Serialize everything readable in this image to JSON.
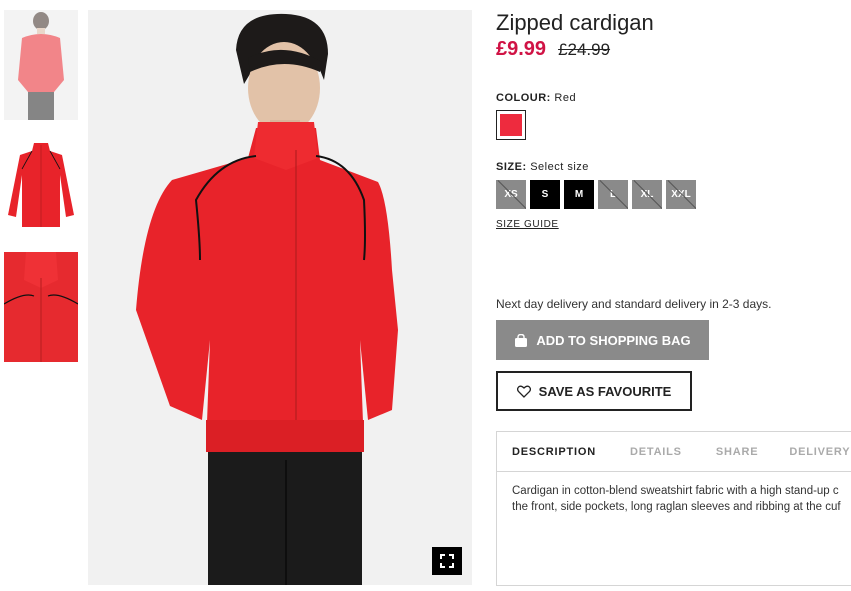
{
  "product": {
    "title": "Zipped cardigan",
    "price_now": "£9.99",
    "price_old": "£24.99"
  },
  "colour": {
    "label": "COLOUR:",
    "value": "Red",
    "swatch_color": "#ee2b3e"
  },
  "size": {
    "label": "SIZE:",
    "prompt": "Select size",
    "options": [
      {
        "label": "XS",
        "available": false
      },
      {
        "label": "S",
        "available": true
      },
      {
        "label": "M",
        "available": true
      },
      {
        "label": "L",
        "available": false
      },
      {
        "label": "XL",
        "available": false
      },
      {
        "label": "XXL",
        "available": false
      }
    ],
    "guide_label": "SIZE GUIDE"
  },
  "delivery_text": "Next day delivery and standard delivery in 2-3 days.",
  "buttons": {
    "add_to_bag": "ADD TO SHOPPING BAG",
    "save_favourite": "SAVE AS FAVOURITE"
  },
  "tabs": [
    "DESCRIPTION",
    "DETAILS",
    "SHARE",
    "DELIVERY"
  ],
  "description": {
    "line1": "Cardigan in cotton-blend sweatshirt fabric with a high stand-up c",
    "line2": "the front, side pockets, long raglan sleeves and ribbing at the cuf"
  },
  "colors": {
    "price_accent": "#d01345",
    "garment_red": "#e8232a",
    "disabled_grey": "#8a8a8a"
  },
  "icons": {
    "zoom": "fullscreen-icon",
    "bag": "shopping-bag-icon",
    "favourite": "heart-icon"
  }
}
